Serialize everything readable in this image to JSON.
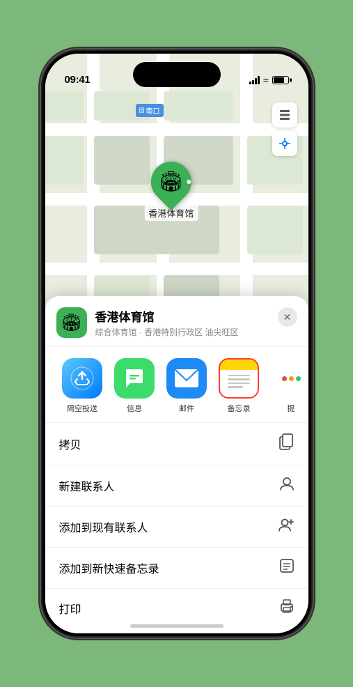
{
  "statusBar": {
    "time": "09:41",
    "timeArrow": "▶"
  },
  "map": {
    "label": "南口",
    "controls": [
      "⊞",
      "◎"
    ]
  },
  "venue": {
    "name": "香港体育馆",
    "description": "综合体育馆 · 香港特别行政区 油尖旺区",
    "icon": "🏟",
    "pinLabel": "香港体育馆"
  },
  "shareItems": [
    {
      "id": "airdrop",
      "label": "隔空投送",
      "emoji": "📡"
    },
    {
      "id": "messages",
      "label": "信息",
      "emoji": "💬"
    },
    {
      "id": "mail",
      "label": "邮件",
      "emoji": "✉️"
    },
    {
      "id": "notes",
      "label": "备忘录",
      "emoji": "📝",
      "highlighted": true
    },
    {
      "id": "more",
      "label": "提",
      "isMore": true
    }
  ],
  "actions": [
    {
      "label": "拷贝",
      "icon": "⎘"
    },
    {
      "label": "新建联系人",
      "icon": "👤"
    },
    {
      "label": "添加到现有联系人",
      "icon": "👤+"
    },
    {
      "label": "添加到新快速备忘录",
      "icon": "📋"
    },
    {
      "label": "打印",
      "icon": "🖨"
    }
  ],
  "closeBtn": "✕"
}
